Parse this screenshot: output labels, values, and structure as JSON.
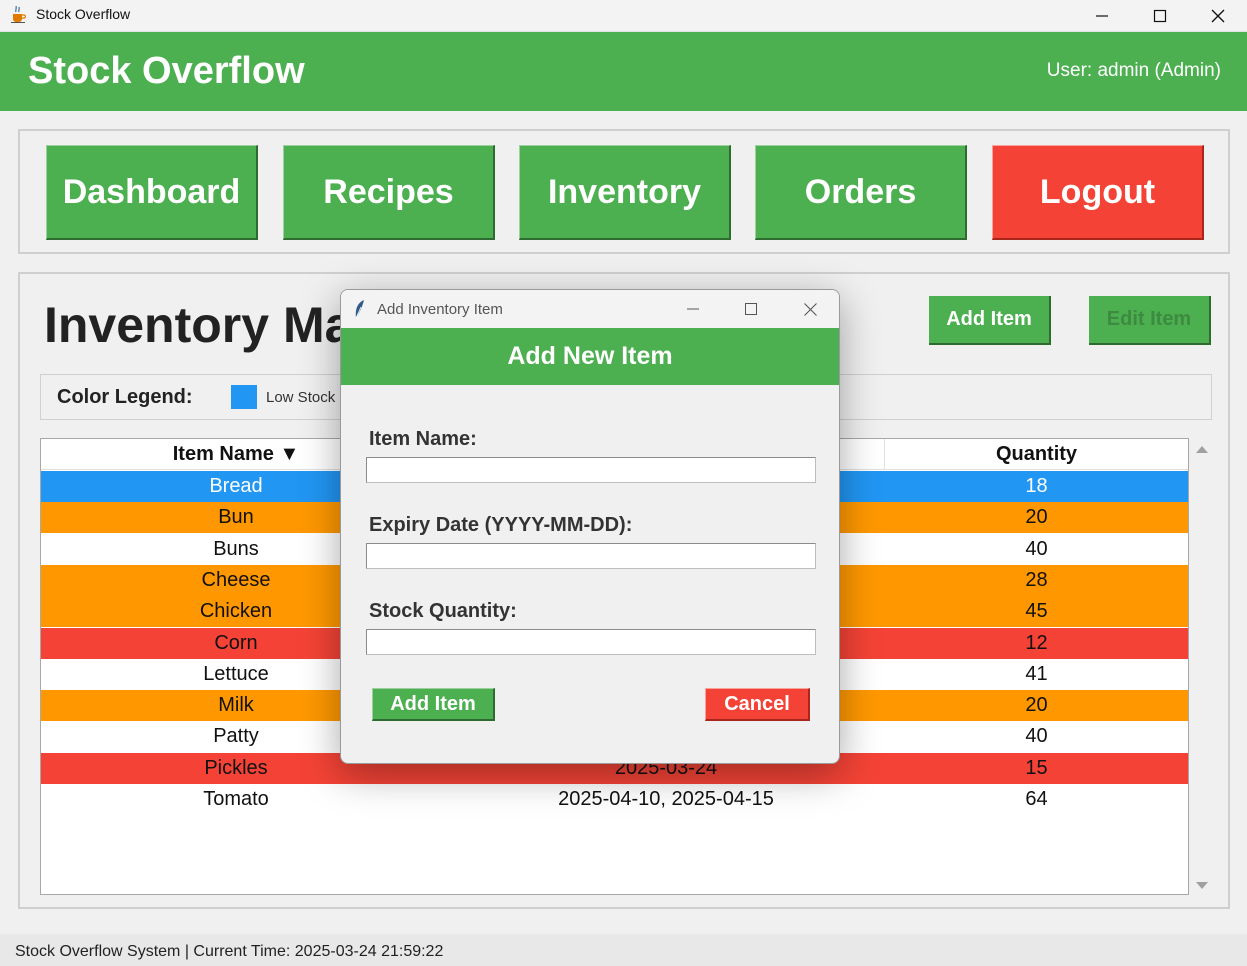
{
  "window": {
    "title": "Stock Overflow",
    "icon": "java-cup-icon"
  },
  "header": {
    "app_title": "Stock Overflow",
    "user_info": "User: admin (Admin)"
  },
  "nav": {
    "dashboard": "Dashboard",
    "recipes": "Recipes",
    "inventory": "Inventory",
    "orders": "Orders",
    "logout": "Logout"
  },
  "page": {
    "title": "Inventory Ma",
    "add_item": "Add Item",
    "edit_item": "Edit Item"
  },
  "legend": {
    "label": "Color Legend:",
    "low_stock": "Low Stock (",
    "low_stock_color": "#2196f3"
  },
  "table": {
    "headers": {
      "name": "Item Name ▼",
      "quantity": "Quantity"
    },
    "rows": [
      {
        "name": "Bread",
        "expiry": "",
        "quantity": "18",
        "status": "blue"
      },
      {
        "name": "Bun",
        "expiry": "",
        "quantity": "20",
        "status": "orange"
      },
      {
        "name": "Buns",
        "expiry": "",
        "quantity": "40",
        "status": "white"
      },
      {
        "name": "Cheese",
        "expiry": "",
        "quantity": "28",
        "status": "orange"
      },
      {
        "name": "Chicken",
        "expiry": "",
        "quantity": "45",
        "status": "orange"
      },
      {
        "name": "Corn",
        "expiry": "",
        "quantity": "12",
        "status": "red"
      },
      {
        "name": "Lettuce",
        "expiry": "",
        "quantity": "41",
        "status": "white"
      },
      {
        "name": "Milk",
        "expiry": "",
        "quantity": "20",
        "status": "orange"
      },
      {
        "name": "Patty",
        "expiry": "",
        "quantity": "40",
        "status": "white"
      },
      {
        "name": "Pickles",
        "expiry": "2025-03-24",
        "quantity": "15",
        "status": "red"
      },
      {
        "name": "Tomato",
        "expiry": "2025-04-10, 2025-04-15",
        "quantity": "64",
        "status": "white"
      }
    ]
  },
  "status_bar": {
    "text": "Stock Overflow System | Current Time: 2025-03-24 21:59:22"
  },
  "dialog": {
    "window_title": "Add Inventory Item",
    "header": "Add New Item",
    "item_name_label": "Item Name:",
    "item_name_value": "",
    "expiry_label": "Expiry Date (YYYY-MM-DD):",
    "expiry_value": "",
    "quantity_label": "Stock Quantity:",
    "quantity_value": "",
    "add_button": "Add Item",
    "cancel_button": "Cancel"
  },
  "colors": {
    "green": "#4caf50",
    "red": "#f44336",
    "orange": "#ff9800",
    "blue": "#2196f3"
  }
}
